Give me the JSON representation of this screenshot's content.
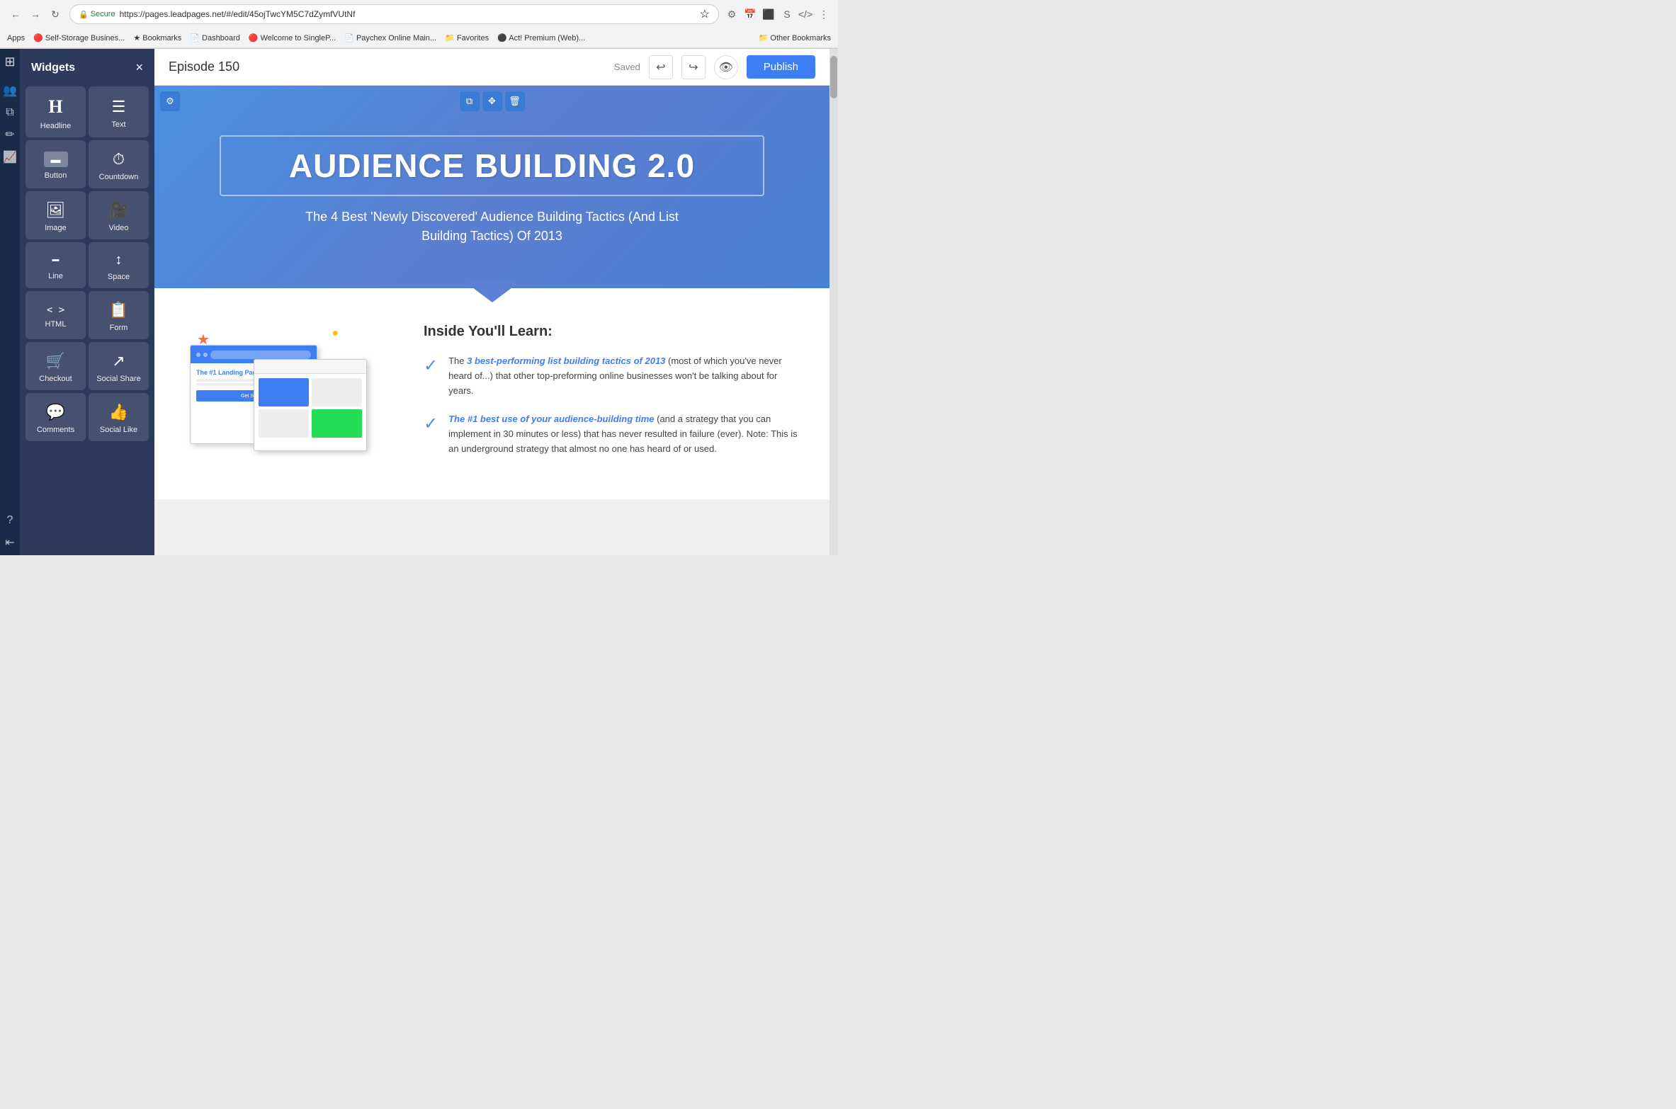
{
  "browser": {
    "url": "https://pages.leadpages.net/#/edit/45ojTwcYM5C7dZymfVUtNf",
    "secure_label": "Secure",
    "bookmarks": [
      {
        "label": "Apps",
        "icon": "🔴"
      },
      {
        "label": "Self-Storage Busines...",
        "icon": "🔴"
      },
      {
        "label": "Bookmarks"
      },
      {
        "label": "Dashboard"
      },
      {
        "label": "Welcome to SingleP..."
      },
      {
        "label": "Paychex Online Main..."
      },
      {
        "label": "Favorites"
      },
      {
        "label": "Act! Premium (Web)..."
      },
      {
        "label": "Other Bookmarks"
      }
    ]
  },
  "topbar": {
    "page_title": "Episode 150",
    "saved_label": "Saved",
    "undo_label": "↩",
    "redo_label": "↪",
    "preview_label": "👁",
    "publish_label": "Publish"
  },
  "widgets_panel": {
    "title": "Widgets",
    "close_label": "×",
    "items": [
      {
        "label": "Headline",
        "icon": "H"
      },
      {
        "label": "Text",
        "icon": "≡"
      },
      {
        "label": "Button",
        "icon": "▬"
      },
      {
        "label": "Countdown",
        "icon": "⏱"
      },
      {
        "label": "Image",
        "icon": "🖼"
      },
      {
        "label": "Video",
        "icon": "🎥"
      },
      {
        "label": "Line",
        "icon": "—"
      },
      {
        "label": "Space",
        "icon": "↕"
      },
      {
        "label": "HTML",
        "icon": "<>"
      },
      {
        "label": "Form",
        "icon": "📋"
      },
      {
        "label": "Checkout",
        "icon": "🛒"
      },
      {
        "label": "Social Share",
        "icon": "↗"
      },
      {
        "label": "Comments",
        "icon": "💬"
      },
      {
        "label": "Social Like",
        "icon": "👍"
      }
    ]
  },
  "canvas": {
    "hero": {
      "headline": "AUDIENCE BUILDING 2.0",
      "subtitle": "The 4 Best 'Newly Discovered' Audience Building Tactics (And List Building Tactics) Of 2013"
    },
    "content": {
      "learn_title": "Inside You'll Learn:",
      "items": [
        {
          "highlight": "3 best-performing list building tactics of 2013",
          "text": " (most of which you've never heard of...) that other top-preforming online businesses won't be talking about for years."
        },
        {
          "highlight": "The #1 best use of your audience-building time",
          "text": " (and a strategy that you can implement in 30 minutes or less) that has never resulted in failure (ever). Note: This is an underground strategy that almost no one has heard of or used."
        }
      ]
    }
  }
}
